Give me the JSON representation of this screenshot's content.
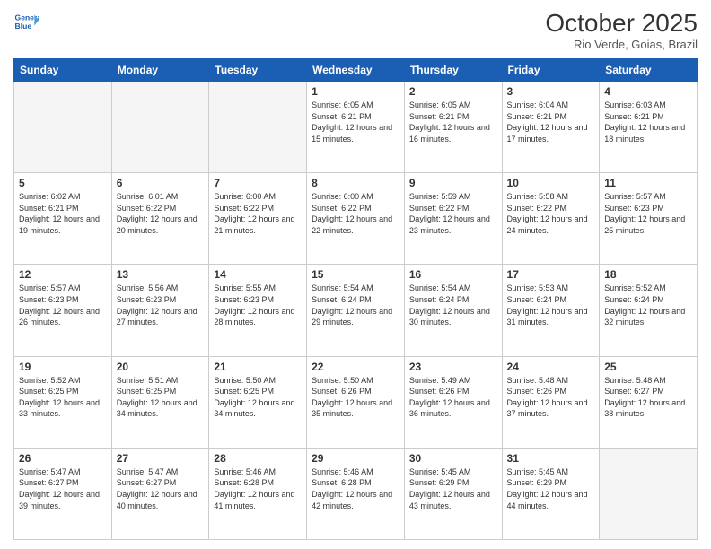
{
  "header": {
    "logo_line1": "General",
    "logo_line2": "Blue",
    "title": "October 2025",
    "subtitle": "Rio Verde, Goias, Brazil"
  },
  "weekdays": [
    "Sunday",
    "Monday",
    "Tuesday",
    "Wednesday",
    "Thursday",
    "Friday",
    "Saturday"
  ],
  "weeks": [
    [
      {
        "day": "",
        "info": ""
      },
      {
        "day": "",
        "info": ""
      },
      {
        "day": "",
        "info": ""
      },
      {
        "day": "1",
        "info": "Sunrise: 6:05 AM\nSunset: 6:21 PM\nDaylight: 12 hours\nand 15 minutes."
      },
      {
        "day": "2",
        "info": "Sunrise: 6:05 AM\nSunset: 6:21 PM\nDaylight: 12 hours\nand 16 minutes."
      },
      {
        "day": "3",
        "info": "Sunrise: 6:04 AM\nSunset: 6:21 PM\nDaylight: 12 hours\nand 17 minutes."
      },
      {
        "day": "4",
        "info": "Sunrise: 6:03 AM\nSunset: 6:21 PM\nDaylight: 12 hours\nand 18 minutes."
      }
    ],
    [
      {
        "day": "5",
        "info": "Sunrise: 6:02 AM\nSunset: 6:21 PM\nDaylight: 12 hours\nand 19 minutes."
      },
      {
        "day": "6",
        "info": "Sunrise: 6:01 AM\nSunset: 6:22 PM\nDaylight: 12 hours\nand 20 minutes."
      },
      {
        "day": "7",
        "info": "Sunrise: 6:00 AM\nSunset: 6:22 PM\nDaylight: 12 hours\nand 21 minutes."
      },
      {
        "day": "8",
        "info": "Sunrise: 6:00 AM\nSunset: 6:22 PM\nDaylight: 12 hours\nand 22 minutes."
      },
      {
        "day": "9",
        "info": "Sunrise: 5:59 AM\nSunset: 6:22 PM\nDaylight: 12 hours\nand 23 minutes."
      },
      {
        "day": "10",
        "info": "Sunrise: 5:58 AM\nSunset: 6:22 PM\nDaylight: 12 hours\nand 24 minutes."
      },
      {
        "day": "11",
        "info": "Sunrise: 5:57 AM\nSunset: 6:23 PM\nDaylight: 12 hours\nand 25 minutes."
      }
    ],
    [
      {
        "day": "12",
        "info": "Sunrise: 5:57 AM\nSunset: 6:23 PM\nDaylight: 12 hours\nand 26 minutes."
      },
      {
        "day": "13",
        "info": "Sunrise: 5:56 AM\nSunset: 6:23 PM\nDaylight: 12 hours\nand 27 minutes."
      },
      {
        "day": "14",
        "info": "Sunrise: 5:55 AM\nSunset: 6:23 PM\nDaylight: 12 hours\nand 28 minutes."
      },
      {
        "day": "15",
        "info": "Sunrise: 5:54 AM\nSunset: 6:24 PM\nDaylight: 12 hours\nand 29 minutes."
      },
      {
        "day": "16",
        "info": "Sunrise: 5:54 AM\nSunset: 6:24 PM\nDaylight: 12 hours\nand 30 minutes."
      },
      {
        "day": "17",
        "info": "Sunrise: 5:53 AM\nSunset: 6:24 PM\nDaylight: 12 hours\nand 31 minutes."
      },
      {
        "day": "18",
        "info": "Sunrise: 5:52 AM\nSunset: 6:24 PM\nDaylight: 12 hours\nand 32 minutes."
      }
    ],
    [
      {
        "day": "19",
        "info": "Sunrise: 5:52 AM\nSunset: 6:25 PM\nDaylight: 12 hours\nand 33 minutes."
      },
      {
        "day": "20",
        "info": "Sunrise: 5:51 AM\nSunset: 6:25 PM\nDaylight: 12 hours\nand 34 minutes."
      },
      {
        "day": "21",
        "info": "Sunrise: 5:50 AM\nSunset: 6:25 PM\nDaylight: 12 hours\nand 34 minutes."
      },
      {
        "day": "22",
        "info": "Sunrise: 5:50 AM\nSunset: 6:26 PM\nDaylight: 12 hours\nand 35 minutes."
      },
      {
        "day": "23",
        "info": "Sunrise: 5:49 AM\nSunset: 6:26 PM\nDaylight: 12 hours\nand 36 minutes."
      },
      {
        "day": "24",
        "info": "Sunrise: 5:48 AM\nSunset: 6:26 PM\nDaylight: 12 hours\nand 37 minutes."
      },
      {
        "day": "25",
        "info": "Sunrise: 5:48 AM\nSunset: 6:27 PM\nDaylight: 12 hours\nand 38 minutes."
      }
    ],
    [
      {
        "day": "26",
        "info": "Sunrise: 5:47 AM\nSunset: 6:27 PM\nDaylight: 12 hours\nand 39 minutes."
      },
      {
        "day": "27",
        "info": "Sunrise: 5:47 AM\nSunset: 6:27 PM\nDaylight: 12 hours\nand 40 minutes."
      },
      {
        "day": "28",
        "info": "Sunrise: 5:46 AM\nSunset: 6:28 PM\nDaylight: 12 hours\nand 41 minutes."
      },
      {
        "day": "29",
        "info": "Sunrise: 5:46 AM\nSunset: 6:28 PM\nDaylight: 12 hours\nand 42 minutes."
      },
      {
        "day": "30",
        "info": "Sunrise: 5:45 AM\nSunset: 6:29 PM\nDaylight: 12 hours\nand 43 minutes."
      },
      {
        "day": "31",
        "info": "Sunrise: 5:45 AM\nSunset: 6:29 PM\nDaylight: 12 hours\nand 44 minutes."
      },
      {
        "day": "",
        "info": ""
      }
    ]
  ]
}
